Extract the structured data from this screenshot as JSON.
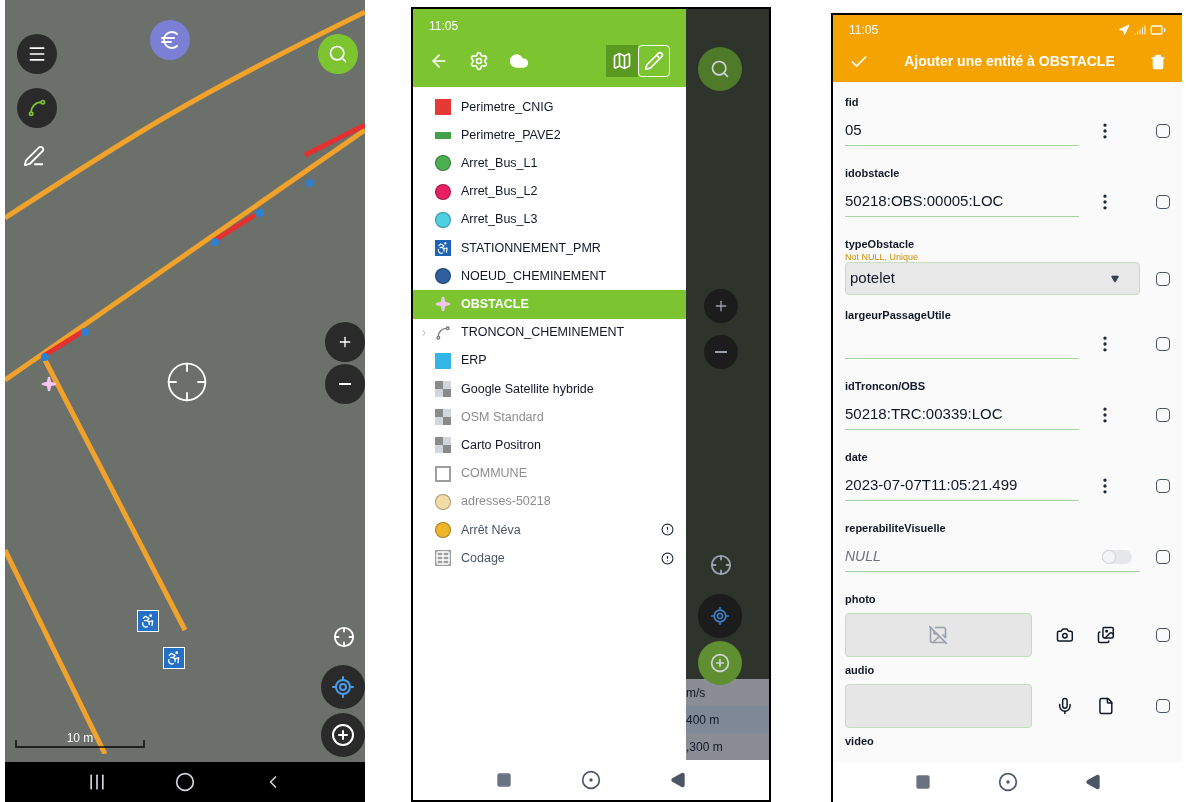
{
  "map_phone": {
    "scale_label": "10 m"
  },
  "layers_phone": {
    "status_time": "11:05",
    "layers": [
      {
        "name": "Perimetre_CNIG",
        "kind": "square",
        "color": "#e53935",
        "selected": false,
        "disabled": false,
        "warning": false,
        "expandable": false
      },
      {
        "name": "Perimetre_PAVE2",
        "kind": "bar",
        "color": "#43a047",
        "selected": false,
        "disabled": false,
        "warning": false,
        "expandable": false
      },
      {
        "name": "Arret_Bus_L1",
        "kind": "circle",
        "color": "#4caf50",
        "selected": false,
        "disabled": false,
        "warning": false,
        "expandable": false
      },
      {
        "name": "Arret_Bus_L2",
        "kind": "circle",
        "color": "#e91e63",
        "selected": false,
        "disabled": false,
        "warning": false,
        "expandable": false
      },
      {
        "name": "Arret_Bus_L3",
        "kind": "circle",
        "color": "#4dd0e1",
        "selected": false,
        "disabled": false,
        "warning": false,
        "expandable": false
      },
      {
        "name": "STATIONNEMENT_PMR",
        "kind": "wheelchair",
        "color": "#1e63b5",
        "selected": false,
        "disabled": false,
        "warning": false,
        "expandable": false
      },
      {
        "name": "NOEUD_CHEMINEMENT",
        "kind": "circle",
        "color": "#2f5f9e",
        "selected": false,
        "disabled": false,
        "warning": false,
        "expandable": false
      },
      {
        "name": "OBSTACLE",
        "kind": "star",
        "color": "#f3c4f0",
        "selected": true,
        "disabled": false,
        "warning": false,
        "expandable": false
      },
      {
        "name": "TRONCON_CHEMINEMENT",
        "kind": "line",
        "color": "#777777",
        "selected": false,
        "disabled": false,
        "warning": false,
        "expandable": true
      },
      {
        "name": "ERP",
        "kind": "square",
        "color": "#33b5e5",
        "selected": false,
        "disabled": false,
        "warning": false,
        "expandable": false
      },
      {
        "name": "Google Satellite hybride",
        "kind": "raster",
        "color": "#8a8a8a",
        "selected": false,
        "disabled": false,
        "warning": false,
        "expandable": false
      },
      {
        "name": "OSM Standard",
        "kind": "raster",
        "color": "#8a8a8a",
        "selected": false,
        "disabled": true,
        "warning": false,
        "expandable": false
      },
      {
        "name": "Carto Positron",
        "kind": "raster",
        "color": "#8a8a8a",
        "selected": false,
        "disabled": false,
        "warning": false,
        "expandable": false
      },
      {
        "name": "COMMUNE",
        "kind": "outline",
        "color": "#9e9e9e",
        "selected": false,
        "disabled": true,
        "warning": false,
        "expandable": false
      },
      {
        "name": "adresses-50218",
        "kind": "circle",
        "color": "#f2dca6",
        "selected": false,
        "disabled": true,
        "warning": false,
        "expandable": false
      },
      {
        "name": "Arrêt Néva",
        "kind": "circle",
        "color": "#f0b429",
        "selected": false,
        "disabled": false,
        "warning": true,
        "expandable": false
      },
      {
        "name": "Codage",
        "kind": "table",
        "color": "#9e9e9e",
        "selected": false,
        "disabled": false,
        "warning": true,
        "expandable": false
      }
    ],
    "map_readings": [
      "m/s",
      "400 m",
      ",300 m"
    ]
  },
  "form_phone": {
    "status_time": "11:05",
    "title": "Ajouter une entité à OBSTACLE",
    "fields": [
      {
        "label": "fid",
        "kind": "text",
        "value": "05",
        "checked": false
      },
      {
        "label": "idobstacle",
        "kind": "text",
        "value": "50218:OBS:00005:LOC",
        "checked": false
      },
      {
        "label": "typeObstacle",
        "kind": "select",
        "hint": "Not NULL, Unique",
        "value": "potelet",
        "checked": false
      },
      {
        "label": "largeurPassageUtile",
        "kind": "text",
        "checked": false
      },
      {
        "label": "idTroncon/OBS",
        "kind": "text",
        "value": "50218:TRC:00339:LOC",
        "checked": false
      },
      {
        "label": "date",
        "kind": "text",
        "value": "2023-07-07T11:05:21.499",
        "checked": false
      },
      {
        "label": "reperabiliteVisuelle",
        "kind": "toggle",
        "placeholder": "NULL",
        "on": false,
        "checked": false
      },
      {
        "label": "photo",
        "kind": "photo",
        "checked": false
      },
      {
        "label": "audio",
        "kind": "audio",
        "checked": false
      },
      {
        "label": "video",
        "kind": "label"
      }
    ]
  }
}
